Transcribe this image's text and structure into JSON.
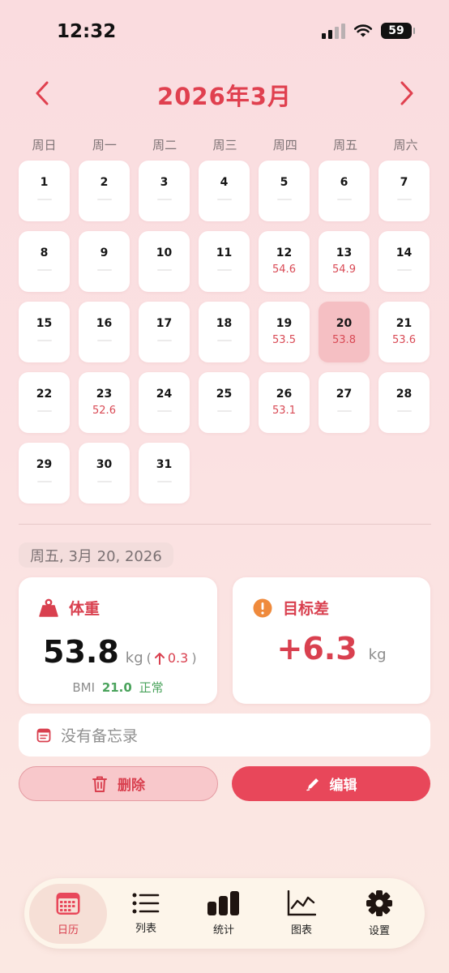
{
  "status": {
    "time": "12:32",
    "battery": "59"
  },
  "header": {
    "title": "2026年3月",
    "prev_icon": "chevron-left-icon",
    "next_icon": "chevron-right-icon"
  },
  "weekdays": [
    "周日",
    "周一",
    "周二",
    "周三",
    "周四",
    "周五",
    "周六"
  ],
  "days": [
    {
      "d": "1",
      "w": ""
    },
    {
      "d": "2",
      "w": ""
    },
    {
      "d": "3",
      "w": ""
    },
    {
      "d": "4",
      "w": ""
    },
    {
      "d": "5",
      "w": ""
    },
    {
      "d": "6",
      "w": ""
    },
    {
      "d": "7",
      "w": ""
    },
    {
      "d": "8",
      "w": ""
    },
    {
      "d": "9",
      "w": ""
    },
    {
      "d": "10",
      "w": ""
    },
    {
      "d": "11",
      "w": ""
    },
    {
      "d": "12",
      "w": "54.6"
    },
    {
      "d": "13",
      "w": "54.9"
    },
    {
      "d": "14",
      "w": ""
    },
    {
      "d": "15",
      "w": ""
    },
    {
      "d": "16",
      "w": ""
    },
    {
      "d": "17",
      "w": ""
    },
    {
      "d": "18",
      "w": ""
    },
    {
      "d": "19",
      "w": "53.5"
    },
    {
      "d": "20",
      "w": "53.8",
      "selected": true
    },
    {
      "d": "21",
      "w": "53.6"
    },
    {
      "d": "22",
      "w": ""
    },
    {
      "d": "23",
      "w": "52.6"
    },
    {
      "d": "24",
      "w": ""
    },
    {
      "d": "25",
      "w": ""
    },
    {
      "d": "26",
      "w": "53.1"
    },
    {
      "d": "27",
      "w": ""
    },
    {
      "d": "28",
      "w": ""
    },
    {
      "d": "29",
      "w": ""
    },
    {
      "d": "30",
      "w": ""
    },
    {
      "d": "31",
      "w": ""
    }
  ],
  "detail": {
    "date": "周五, 3月 20, 2026",
    "weight_card": {
      "title": "体重",
      "value": "53.8",
      "unit": "kg",
      "paren_open": "(",
      "change": "0.3",
      "paren_close": ")",
      "bmi_label": "BMI",
      "bmi_value": "21.0",
      "bmi_status": "正常"
    },
    "goal_card": {
      "title": "目标差",
      "value": "+6.3",
      "unit": "kg"
    },
    "memo": "没有备忘录",
    "delete_label": "删除",
    "edit_label": "编辑"
  },
  "tabs": [
    {
      "label": "日历",
      "icon": "calendar-icon",
      "active": true
    },
    {
      "label": "列表",
      "icon": "list-icon"
    },
    {
      "label": "统计",
      "icon": "bar-chart-icon"
    },
    {
      "label": "图表",
      "icon": "line-chart-icon"
    },
    {
      "label": "设置",
      "icon": "gear-icon"
    }
  ],
  "colors": {
    "accent": "#e0404f",
    "selected": "#f5bfc3",
    "positive": "#4aa35c"
  }
}
